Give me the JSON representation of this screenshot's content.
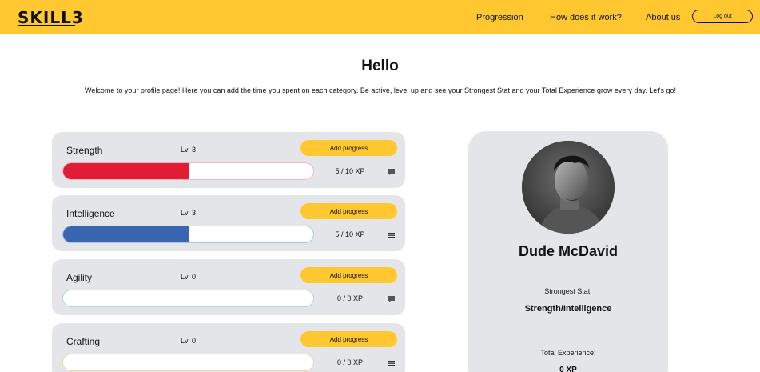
{
  "header": {
    "logo": "SKILL3",
    "nav": [
      "Progression",
      "How does it work?",
      "About us"
    ],
    "logout_label": "Log out",
    "background": "#ffc830"
  },
  "intro": {
    "title": "Hello",
    "text": "Welcome to your profile page! Here you can add the time you spent on each category. Be active, level up and see your Strongest Stat and your Total Experience grow every day. Let's go!"
  },
  "stats": [
    {
      "name": "Strength",
      "level": "Lvl 3",
      "button": "Add progress",
      "xp": "5 / 10 XP",
      "progress": 0.5,
      "color": "#e11d35",
      "icon": "comment-icon"
    },
    {
      "name": "Intelligence",
      "level": "Lvl 3",
      "button": "Add progress",
      "xp": "5 / 10 XP",
      "progress": 0.5,
      "color": "#3866b0",
      "icon": "list-icon"
    },
    {
      "name": "Agility",
      "level": "Lvl 0",
      "button": "Add progress",
      "xp": "0 / 0 XP",
      "progress": 0,
      "color": "#2ea886",
      "icon": "comment-icon"
    },
    {
      "name": "Crafting",
      "level": "Lvl 0",
      "button": "Add progress",
      "xp": "0 / 0 XP",
      "progress": 0,
      "color": "#d9a830",
      "icon": "list-icon"
    }
  ],
  "profile": {
    "name": "Dude McDavid",
    "strongest_label": "Strongest Stat:",
    "strongest_value": "Strength/Intelligence",
    "total_label": "Total Experience:",
    "total_value": "0 XP"
  }
}
